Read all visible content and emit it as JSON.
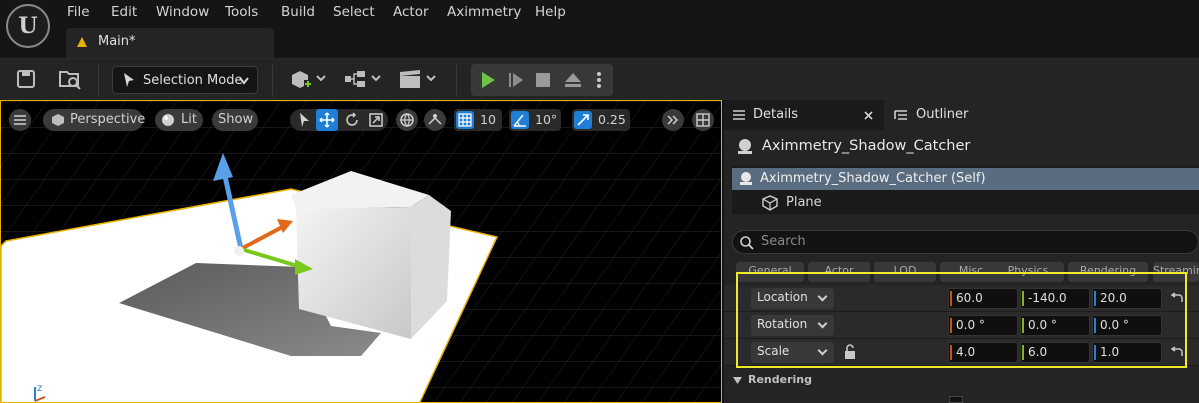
{
  "app": {
    "logo_letter": "U"
  },
  "menu": [
    "File",
    "Edit",
    "Window",
    "Tools",
    "Build",
    "Select",
    "Actor",
    "Aximmetry",
    "Help"
  ],
  "document_tab": {
    "label": "Main*"
  },
  "toolbar": {
    "save_icon": "save-icon",
    "browse_icon": "content-browser-icon",
    "selection_mode_label": "Selection Mode",
    "add_icon": "add-actor-icon",
    "blueprint_icon": "blueprint-icon",
    "cinematics_icon": "clapperboard-icon",
    "play_icon": "play-icon",
    "step_icon": "step-icon",
    "stop_icon": "stop-icon",
    "eject_icon": "eject-icon",
    "more_icon": "kebab-icon"
  },
  "viewport": {
    "perspective_label": "Perspective",
    "lit_label": "Lit",
    "show_label": "Show",
    "grid_snap_value": "10",
    "rotation_snap_value": "10°",
    "scale_snap_value": "0.25",
    "colors": {
      "grid": "#2a2a2a",
      "border": "#e8b000",
      "plane": "#ffffff",
      "gizmo_up": "#5aa0e8",
      "gizmo_forward": "#e06a1a",
      "gizmo_side": "#7ac81e"
    }
  },
  "panel": {
    "details_tab": "Details",
    "outliner_tab": "Outliner",
    "actor_name": "Aximmetry_Shadow_Catcher",
    "tree": [
      {
        "label": "Aximmetry_Shadow_Catcher (Self)",
        "selected": true
      },
      {
        "label": "Plane",
        "selected": false
      }
    ],
    "search_placeholder": "Search",
    "categories": [
      "General",
      "Actor",
      "LOD",
      "Misc",
      "Physics",
      "Rendering",
      "Streaming"
    ],
    "transform": [
      {
        "label": "Location",
        "values": [
          "60.0",
          "-140.0",
          "20.0"
        ]
      },
      {
        "label": "Rotation",
        "values": [
          "0.0 °",
          "0.0 °",
          "0.0 °"
        ]
      },
      {
        "label": "Scale",
        "values": [
          "4.0",
          "6.0",
          "1.0"
        ]
      }
    ],
    "section_rendering": "Rendering",
    "axis_colors": {
      "x": "#c8531a",
      "y": "#86b51e",
      "z": "#2f7fd0"
    },
    "highlight_color": "#f2e82a"
  }
}
